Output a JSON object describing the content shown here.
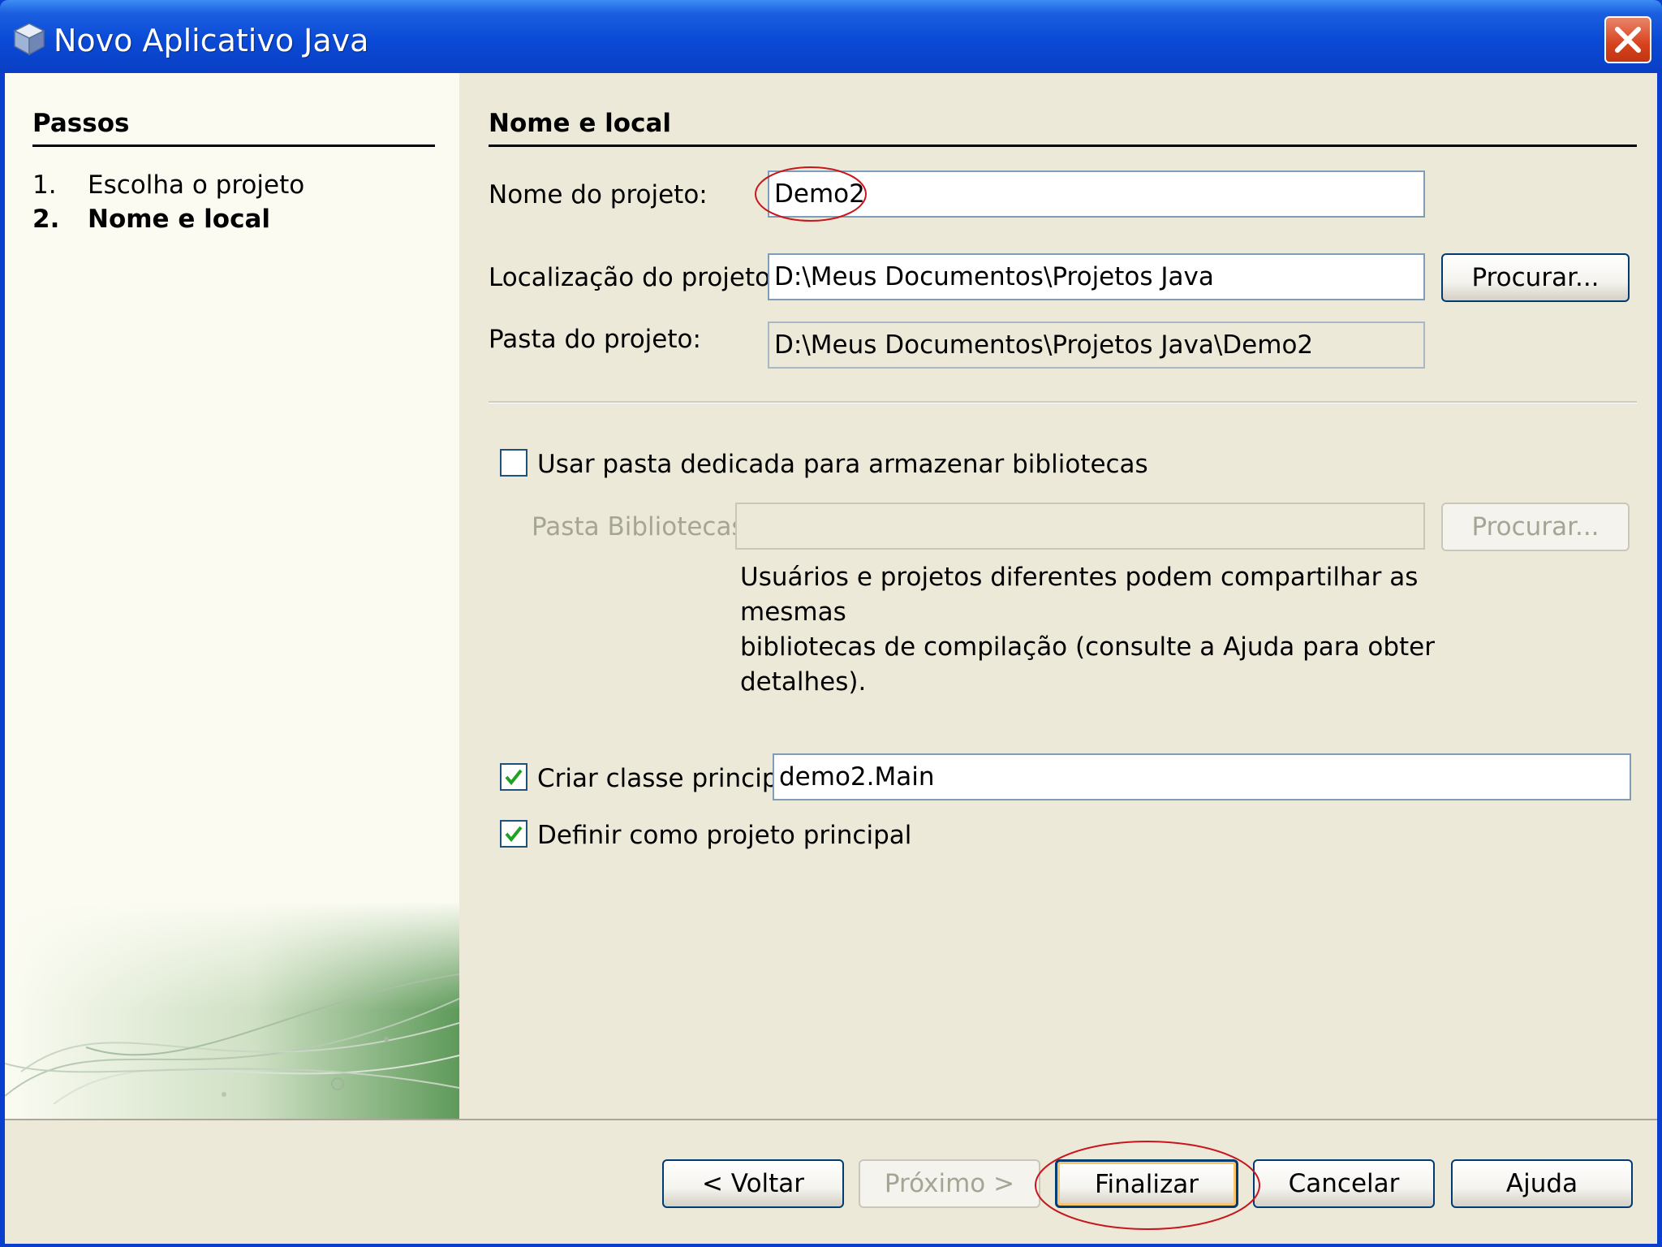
{
  "window": {
    "title": "Novo Aplicativo Java",
    "icon": "java-cube-icon",
    "close_icon": "close-icon"
  },
  "steps": {
    "heading": "Passos",
    "items": [
      {
        "number": "1.",
        "label": "Escolha o projeto",
        "current": false
      },
      {
        "number": "2.",
        "label": "Nome e local",
        "current": true
      }
    ]
  },
  "form": {
    "heading": "Nome e local",
    "project_name_label": "Nome do projeto:",
    "project_name_value": "Demo2",
    "project_location_label": "Localização do projeto:",
    "project_location_value": "D:\\Meus Documentos\\Projetos Java",
    "browse_label": "Procurar...",
    "project_folder_label": "Pasta do projeto:",
    "project_folder_value": "D:\\Meus Documentos\\Projetos Java\\Demo2",
    "dedicated_libs_label": "Usar pasta dedicada para armazenar bibliotecas",
    "dedicated_libs_checked": false,
    "libs_folder_label": "Pasta Bibliotecas:",
    "libs_folder_value": "",
    "libs_browse_label": "Procurar...",
    "libs_help_lines": [
      "Usuários e projetos diferentes podem compartilhar as mesmas",
      "bibliotecas de compilação (consulte a Ajuda para obter",
      "detalhes)."
    ],
    "create_main_label": "Criar classe principal",
    "create_main_checked": true,
    "main_class_value": "demo2.Main",
    "set_main_project_label": "Definir como projeto principal",
    "set_main_project_checked": true
  },
  "buttons": {
    "back": "< Voltar",
    "next": "Próximo >",
    "finish": "Finalizar",
    "cancel": "Cancelar",
    "help": "Ajuda"
  },
  "colors": {
    "titlebar": "#0a4ad6",
    "dialog_bg": "#ece9d8",
    "annotation": "#c8161d"
  }
}
